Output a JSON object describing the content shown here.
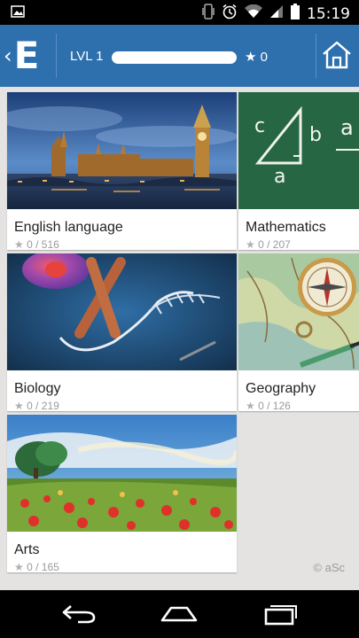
{
  "status_bar": {
    "time": "15:19",
    "icons": [
      "image-notification-icon",
      "vibrate-icon",
      "alarm-icon",
      "wifi-icon",
      "signal-icon",
      "battery-icon"
    ]
  },
  "app_bar": {
    "logo_letter": "E",
    "level_label": "LVL 1",
    "progress": 0,
    "stars_label": "★ 0",
    "accent_color": "#2e6fae"
  },
  "subjects": [
    {
      "title": "English language",
      "score": "0 / 516"
    },
    {
      "title": "Mathematics",
      "score": "0 / 207"
    },
    {
      "title": "Biology",
      "score": "0 / 219"
    },
    {
      "title": "Geography",
      "score": "0 / 126"
    },
    {
      "title": "Arts",
      "score": "0 / 165"
    }
  ],
  "credit": "© aSc",
  "nav_bar": {
    "icons": [
      "back-icon",
      "home-icon",
      "recents-icon"
    ]
  }
}
